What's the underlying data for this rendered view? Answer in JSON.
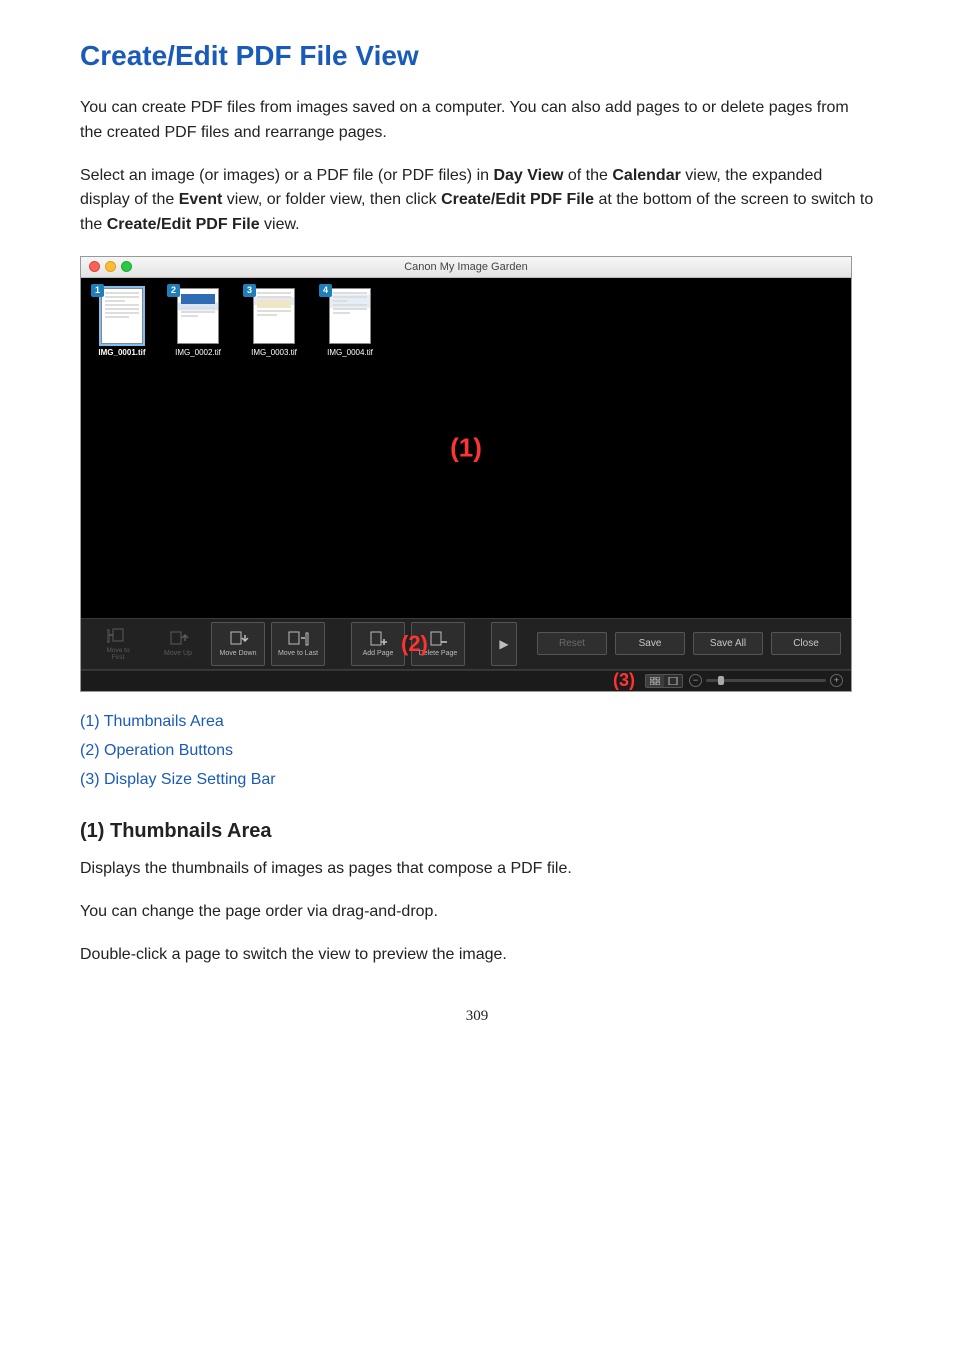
{
  "heading": "Create/Edit PDF File View",
  "intro_p1": "You can create PDF files from images saved on a computer. You can also add pages to or delete pages from the created PDF files and rearrange pages.",
  "intro_p2_a": "Select an image (or images) or a PDF file (or PDF files) in ",
  "intro_p2_b": "Day View",
  "intro_p2_c": " of the ",
  "intro_p2_d": "Calendar",
  "intro_p2_e": " view, the expanded display of the ",
  "intro_p2_f": "Event",
  "intro_p2_g": " view, or folder view, then click ",
  "intro_p2_h": "Create/Edit PDF File",
  "intro_p2_i": " at the bottom of the screen to switch to the ",
  "intro_p2_j": "Create/Edit PDF File",
  "intro_p2_k": " view.",
  "app": {
    "title": "Canon My Image Garden",
    "thumbs": [
      {
        "num": "1",
        "fname": "IMG_0001.tif",
        "selected": true
      },
      {
        "num": "2",
        "fname": "IMG_0002.tif",
        "selected": false
      },
      {
        "num": "3",
        "fname": "IMG_0003.tif",
        "selected": false
      },
      {
        "num": "4",
        "fname": "IMG_0004.tif",
        "selected": false
      }
    ],
    "annot1": "(1)",
    "annot2": "(2)",
    "annot3": "(3)",
    "toolbar": {
      "move_first": "Move to\nFirst",
      "move_up": "Move Up",
      "move_down": "Move Down",
      "move_last": "Move to Last",
      "add_page": "Add Page",
      "delete_page": "Delete Page",
      "arrow": "▶",
      "reset": "Reset",
      "save": "Save",
      "save_all": "Save All",
      "close": "Close"
    },
    "statusbar": {
      "minus": "−",
      "plus": "+"
    }
  },
  "links": {
    "l1": "(1) Thumbnails Area",
    "l2": "(2) Operation Buttons",
    "l3": "(3) Display Size Setting Bar"
  },
  "section1": {
    "head": "(1) Thumbnails Area",
    "p1": "Displays the thumbnails of images as pages that compose a PDF file.",
    "p2": "You can change the page order via drag-and-drop.",
    "p3": "Double-click a page to switch the view to preview the image."
  },
  "page_number": "309"
}
